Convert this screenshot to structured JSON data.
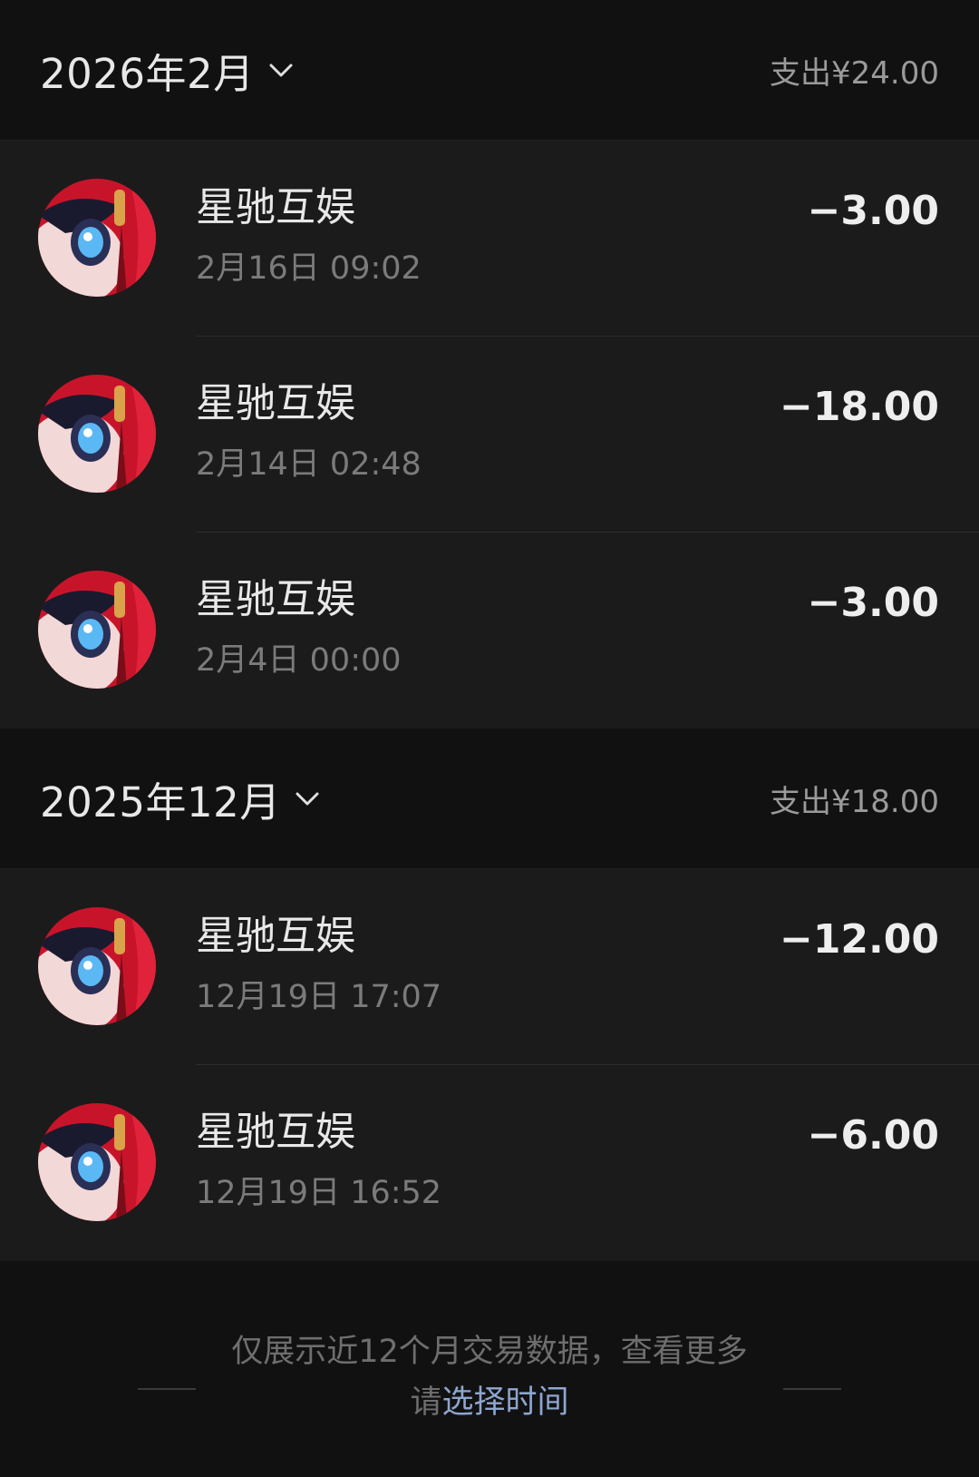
{
  "months": [
    {
      "title": "2026年2月",
      "summary": "支出¥24.00",
      "transactions": [
        {
          "name": "星驰互娱",
          "time": "2月16日 09:02",
          "amount": "−3.00"
        },
        {
          "name": "星驰互娱",
          "time": "2月14日 02:48",
          "amount": "−18.00"
        },
        {
          "name": "星驰互娱",
          "time": "2月4日 00:00",
          "amount": "−3.00"
        }
      ]
    },
    {
      "title": "2025年12月",
      "summary": "支出¥18.00",
      "transactions": [
        {
          "name": "星驰互娱",
          "time": "12月19日 17:07",
          "amount": "−12.00"
        },
        {
          "name": "星驰互娱",
          "time": "12月19日 16:52",
          "amount": "−6.00"
        }
      ]
    }
  ],
  "footer": {
    "text": "仅展示近12个月交易数据，查看更多请",
    "link": "选择时间"
  },
  "icons": {
    "month_toggle": "chevron-down-icon",
    "merchant_avatar": "avatar"
  },
  "colors": {
    "background": "#111111",
    "list_background": "#1b1b1b",
    "link": "#8ea6cf",
    "secondary_text": "#7b7b7b"
  }
}
